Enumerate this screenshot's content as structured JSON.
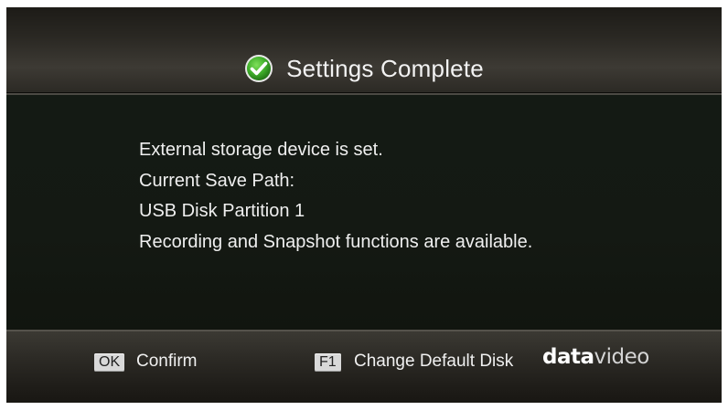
{
  "dialog": {
    "title": "Settings Complete",
    "status_icon": "check-circle-icon",
    "accent_color": "#3fae2a"
  },
  "message": {
    "lines": [
      "External storage device is set.",
      "Current Save Path:",
      "USB Disk Partition 1",
      "Recording and Snapshot functions are available."
    ]
  },
  "footer": {
    "confirm_key": "OK",
    "confirm_label": "Confirm",
    "change_key": "F1",
    "change_label": "Change Default Disk",
    "brand_bold": "data",
    "brand_light": "video"
  }
}
